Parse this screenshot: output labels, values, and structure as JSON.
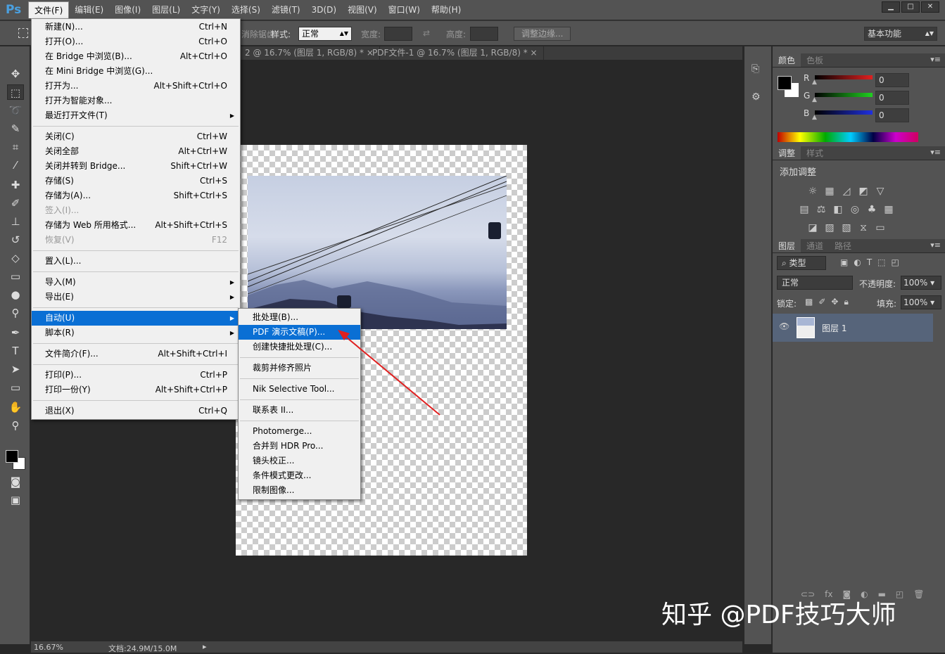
{
  "app": {
    "logo": "Ps",
    "window_buttons": [
      "▁",
      "□",
      "✕"
    ]
  },
  "menubar": [
    "文件(F)",
    "编辑(E)",
    "图像(I)",
    "图层(L)",
    "文字(Y)",
    "选择(S)",
    "滤镜(T)",
    "3D(D)",
    "视图(V)",
    "窗口(W)",
    "帮助(H)"
  ],
  "options": {
    "partial_label": "消除锯齿",
    "style_label": "样式:",
    "style_value": "正常",
    "width_label": "宽度:",
    "height_label": "高度:",
    "refine_edge": "调整边缘...",
    "workspace": "基本功能"
  },
  "doc_tabs": [
    {
      "title": "2 @ 16.7% (图层 1, RGB/8) *",
      "close": "×"
    },
    {
      "title": "PDF文件-1 @ 16.7% (图层 1, RGB/8) *",
      "close": "×"
    }
  ],
  "file_menu": [
    [
      {
        "label": "新建(N)...",
        "shortcut": "Ctrl+N"
      },
      {
        "label": "打开(O)...",
        "shortcut": "Ctrl+O"
      },
      {
        "label": "在 Bridge 中浏览(B)...",
        "shortcut": "Alt+Ctrl+O"
      },
      {
        "label": "在 Mini Bridge 中浏览(G)...",
        "shortcut": ""
      },
      {
        "label": "打开为...",
        "shortcut": "Alt+Shift+Ctrl+O"
      },
      {
        "label": "打开为智能对象...",
        "shortcut": ""
      },
      {
        "label": "最近打开文件(T)",
        "shortcut": "",
        "submenu": true
      }
    ],
    [
      {
        "label": "关闭(C)",
        "shortcut": "Ctrl+W"
      },
      {
        "label": "关闭全部",
        "shortcut": "Alt+Ctrl+W"
      },
      {
        "label": "关闭并转到 Bridge...",
        "shortcut": "Shift+Ctrl+W"
      },
      {
        "label": "存储(S)",
        "shortcut": "Ctrl+S"
      },
      {
        "label": "存储为(A)...",
        "shortcut": "Shift+Ctrl+S"
      },
      {
        "label": "签入(I)...",
        "shortcut": "",
        "disabled": true
      },
      {
        "label": "存储为 Web 所用格式...",
        "shortcut": "Alt+Shift+Ctrl+S"
      },
      {
        "label": "恢复(V)",
        "shortcut": "F12",
        "disabled": true
      }
    ],
    [
      {
        "label": "置入(L)...",
        "shortcut": ""
      }
    ],
    [
      {
        "label": "导入(M)",
        "shortcut": "",
        "submenu": true
      },
      {
        "label": "导出(E)",
        "shortcut": "",
        "submenu": true
      }
    ],
    [
      {
        "label": "自动(U)",
        "shortcut": "",
        "submenu": true,
        "highlighted": true
      },
      {
        "label": "脚本(R)",
        "shortcut": "",
        "submenu": true
      }
    ],
    [
      {
        "label": "文件简介(F)...",
        "shortcut": "Alt+Shift+Ctrl+I"
      }
    ],
    [
      {
        "label": "打印(P)...",
        "shortcut": "Ctrl+P"
      },
      {
        "label": "打印一份(Y)",
        "shortcut": "Alt+Shift+Ctrl+P"
      }
    ],
    [
      {
        "label": "退出(X)",
        "shortcut": "Ctrl+Q"
      }
    ]
  ],
  "automate_menu": [
    [
      {
        "label": "批处理(B)..."
      },
      {
        "label": "PDF 演示文稿(P)...",
        "highlighted": true
      },
      {
        "label": "创建快捷批处理(C)..."
      }
    ],
    [
      {
        "label": "裁剪并修齐照片"
      }
    ],
    [
      {
        "label": "Nik Selective Tool..."
      }
    ],
    [
      {
        "label": "联系表 II..."
      }
    ],
    [
      {
        "label": "Photomerge..."
      },
      {
        "label": "合并到 HDR Pro..."
      },
      {
        "label": "镜头校正..."
      },
      {
        "label": "条件模式更改..."
      },
      {
        "label": "限制图像..."
      }
    ]
  ],
  "color_panel": {
    "tabs": [
      "颜色",
      "色板"
    ],
    "channels": [
      {
        "label": "R",
        "value": "0",
        "color": "#e02020"
      },
      {
        "label": "G",
        "value": "0",
        "color": "#20d020"
      },
      {
        "label": "B",
        "value": "0",
        "color": "#2030e0"
      }
    ],
    "foreground": "#000000",
    "background": "#ffffff"
  },
  "adjust_panel": {
    "tabs": [
      "调整",
      "样式"
    ],
    "heading": "添加调整"
  },
  "layers_panel": {
    "tabs": [
      "图层",
      "通道",
      "路径"
    ],
    "filter": "类型",
    "blend_mode": "正常",
    "opacity_label": "不透明度:",
    "opacity": "100%",
    "lock_label": "锁定:",
    "fill_label": "填充:",
    "fill": "100%",
    "layers": [
      {
        "name": "图层 1",
        "visible": true,
        "selected": true
      }
    ]
  },
  "status": {
    "zoom": "16.67%",
    "doc": "文档:24.9M/15.0M"
  },
  "watermark": "知乎 @PDF技巧大师",
  "colors": {
    "highlight": "#0a6fd4",
    "arrow": "#e02020"
  }
}
